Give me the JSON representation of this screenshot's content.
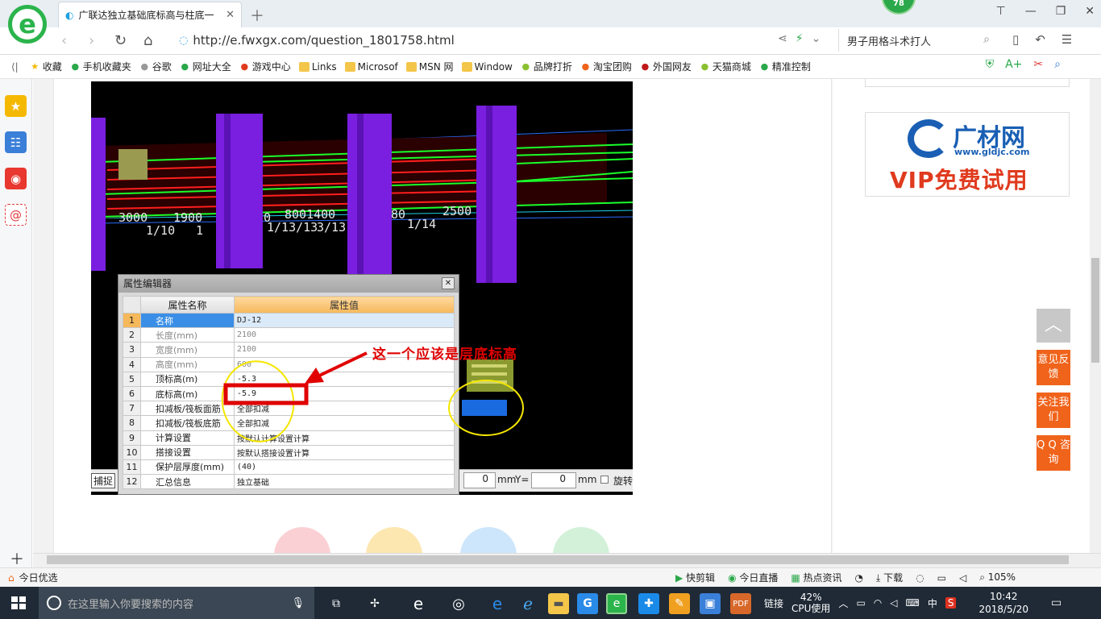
{
  "browser": {
    "tab_title": "广联达独立基础底标高与柱底一",
    "badge": "78",
    "url": "http://e.fwxgx.com/question_1801758.html",
    "search_value": "男子用格斗术打人",
    "zoom": "105%"
  },
  "bookmarks": [
    {
      "label": "收藏",
      "icon": "star-icon"
    },
    {
      "label": "手机收藏夹",
      "icon": "phone-icon"
    },
    {
      "label": "谷歌",
      "icon": "page-icon"
    },
    {
      "label": "网址大全",
      "icon": "globe-icon"
    },
    {
      "label": "游戏中心",
      "icon": "game-icon"
    },
    {
      "label": "Links",
      "icon": "folder-icon"
    },
    {
      "label": "Microsof",
      "icon": "folder-icon"
    },
    {
      "label": "MSN 网",
      "icon": "folder-icon"
    },
    {
      "label": "Window",
      "icon": "folder-icon"
    },
    {
      "label": "品牌打折",
      "icon": "leaf-icon"
    },
    {
      "label": "淘宝团购",
      "icon": "taobao-icon"
    },
    {
      "label": "外国网友",
      "icon": "flag-icon"
    },
    {
      "label": "天猫商城",
      "icon": "leaf-icon"
    },
    {
      "label": "精准控制",
      "icon": "chat-icon"
    }
  ],
  "ad": {
    "name": "广材网",
    "url": "www.gldjc.com",
    "slogan": "VIP免费试用"
  },
  "dialog": {
    "title": "属性编辑器",
    "col_name": "属性名称",
    "col_value": "属性值",
    "rows": [
      {
        "n": "1",
        "name": "名称",
        "value": "DJ-12",
        "sel": true,
        "grey": false
      },
      {
        "n": "2",
        "name": "长度(mm)",
        "value": "2100",
        "sel": false,
        "grey": true
      },
      {
        "n": "3",
        "name": "宽度(mm)",
        "value": "2100",
        "sel": false,
        "grey": true
      },
      {
        "n": "4",
        "name": "高度(mm)",
        "value": "600",
        "sel": false,
        "grey": true
      },
      {
        "n": "5",
        "name": "顶标高(m)",
        "value": "-5.3",
        "sel": false,
        "grey": false
      },
      {
        "n": "6",
        "name": "底标高(m)",
        "value": "-5.9",
        "sel": false,
        "grey": false
      },
      {
        "n": "7",
        "name": "扣减板/筏板面筋",
        "value": "全部扣减",
        "sel": false,
        "grey": false
      },
      {
        "n": "8",
        "name": "扣减板/筏板底筋",
        "value": "全部扣减",
        "sel": false,
        "grey": false
      },
      {
        "n": "9",
        "name": "计算设置",
        "value": "按默认计算设置计算",
        "sel": false,
        "grey": false
      },
      {
        "n": "10",
        "name": "搭接设置",
        "value": "按默认搭接设置计算",
        "sel": false,
        "grey": false
      },
      {
        "n": "11",
        "name": "保护层厚度(mm)",
        "value": "(40)",
        "sel": false,
        "grey": false
      },
      {
        "n": "12",
        "name": "汇总信息",
        "value": "独立基础",
        "sel": false,
        "grey": false
      }
    ]
  },
  "annotation": "这一个应该是层底标高",
  "cad_labels": [
    "3000",
    "1/10",
    "1900",
    "1",
    "0",
    "8001400",
    "1/13/13",
    "3/13",
    "80",
    "1/14",
    "2500"
  ],
  "cad_statusbar": {
    "snap": "捕捉",
    "x_value": "0",
    "x_unit": "mm",
    "y_label": "Y=",
    "y_value": "0",
    "y_unit": "mm",
    "rotate": "旋转"
  },
  "float_buttons": {
    "feedback": "意见反馈",
    "follow": "关注我们",
    "qq": "Q Q 咨询"
  },
  "statusbar": {
    "left": "今日优选",
    "items": [
      "快剪辑",
      "今日直播",
      "热点资讯",
      "下载"
    ]
  },
  "taskbar": {
    "search_placeholder": "在这里输入你要搜索的内容",
    "link": "链接",
    "cpu_percent": "42%",
    "cpu_label": "CPU使用",
    "ime": "中",
    "time": "10:42",
    "date": "2018/5/20"
  },
  "colors": {
    "orange": "#f0631a",
    "annotation_red": "#e00000",
    "highlight_yellow": "#f5e600"
  }
}
